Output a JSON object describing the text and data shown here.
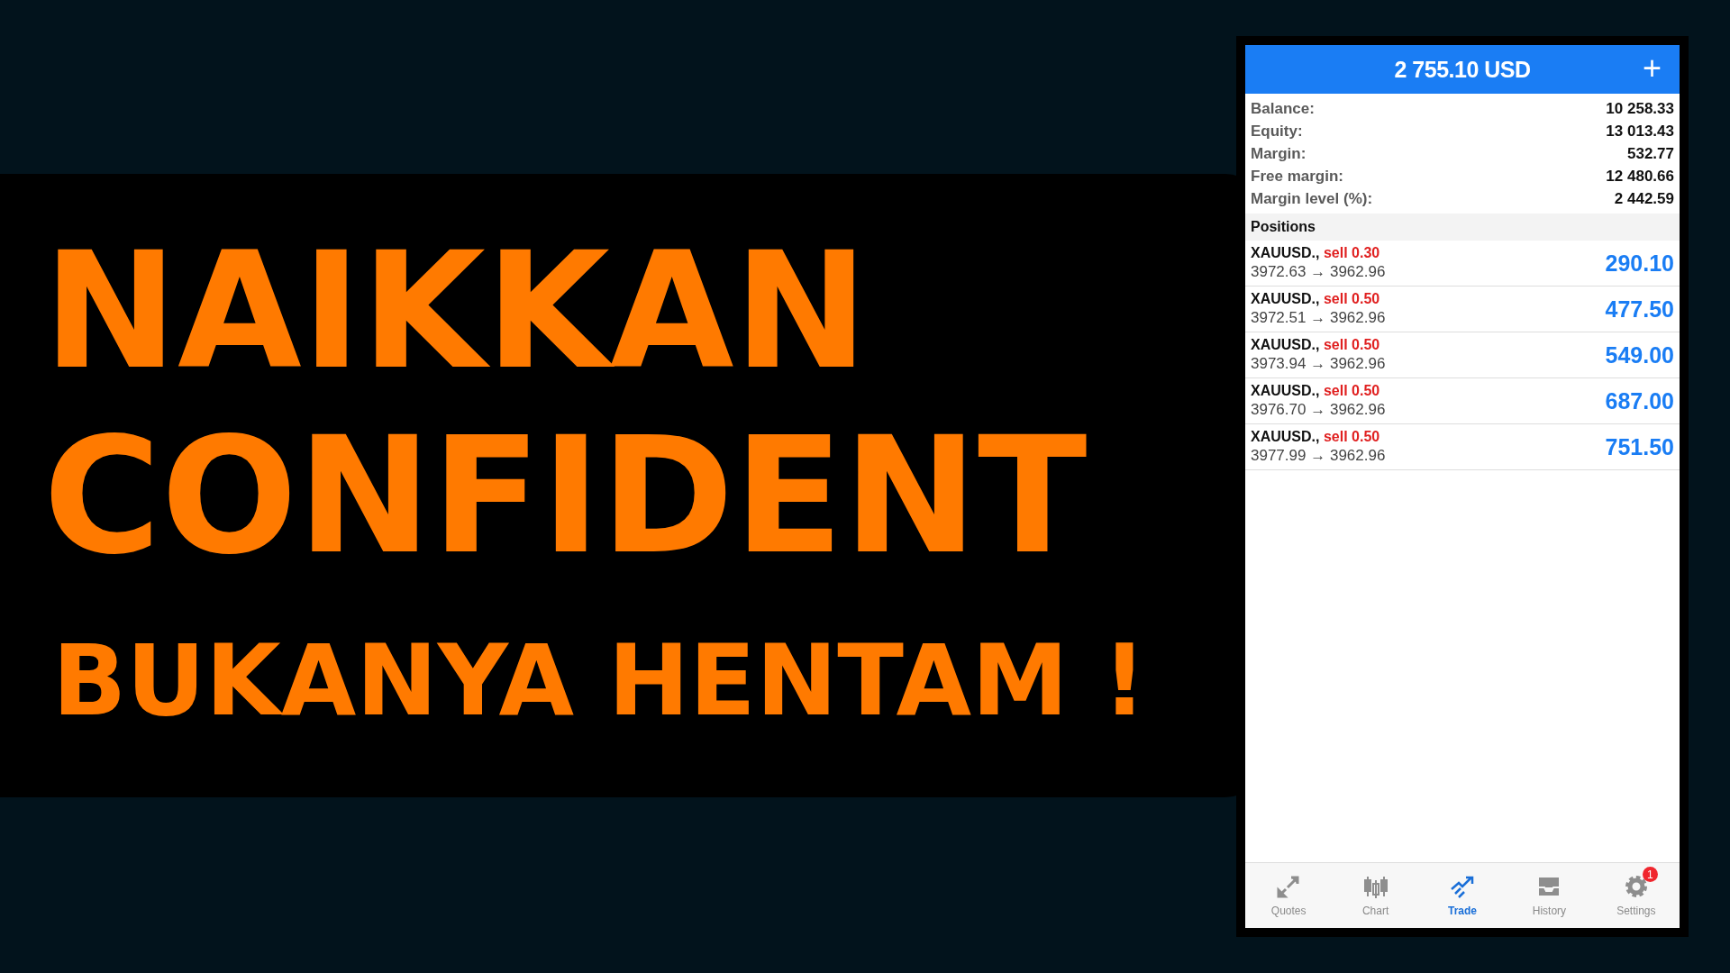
{
  "headline": {
    "lines": [
      "NAIKKAN",
      "CONFIDENT"
    ],
    "subline": "BUKANYA HENTAM !"
  },
  "app": {
    "header": {
      "title": "2 755.10 USD",
      "add_icon": "+"
    },
    "summary": [
      {
        "label": "Balance:",
        "value": "10 258.33"
      },
      {
        "label": "Equity:",
        "value": "13 013.43"
      },
      {
        "label": "Margin:",
        "value": "532.77"
      },
      {
        "label": "Free margin:",
        "value": "12 480.66"
      },
      {
        "label": "Margin level (%):",
        "value": "2 442.59"
      }
    ],
    "positions_title": "Positions",
    "positions": [
      {
        "symbol": "XAUUSD.,",
        "side": "sell 0.30",
        "open": "3972.63",
        "arrow": "→",
        "current": "3962.96",
        "profit": "290.10"
      },
      {
        "symbol": "XAUUSD.,",
        "side": "sell 0.50",
        "open": "3972.51",
        "arrow": "→",
        "current": "3962.96",
        "profit": "477.50"
      },
      {
        "symbol": "XAUUSD.,",
        "side": "sell 0.50",
        "open": "3973.94",
        "arrow": "→",
        "current": "3962.96",
        "profit": "549.00"
      },
      {
        "symbol": "XAUUSD.,",
        "side": "sell 0.50",
        "open": "3976.70",
        "arrow": "→",
        "current": "3962.96",
        "profit": "687.00"
      },
      {
        "symbol": "XAUUSD.,",
        "side": "sell 0.50",
        "open": "3977.99",
        "arrow": "→",
        "current": "3962.96",
        "profit": "751.50"
      }
    ],
    "tabs": [
      {
        "label": "Quotes",
        "kind": "quotes",
        "selected": false
      },
      {
        "label": "Chart",
        "kind": "chart",
        "selected": false
      },
      {
        "label": "Trade",
        "kind": "trade",
        "selected": true
      },
      {
        "label": "History",
        "kind": "history",
        "selected": false
      },
      {
        "label": "Settings",
        "kind": "settings",
        "selected": false,
        "badge": "1"
      }
    ]
  }
}
